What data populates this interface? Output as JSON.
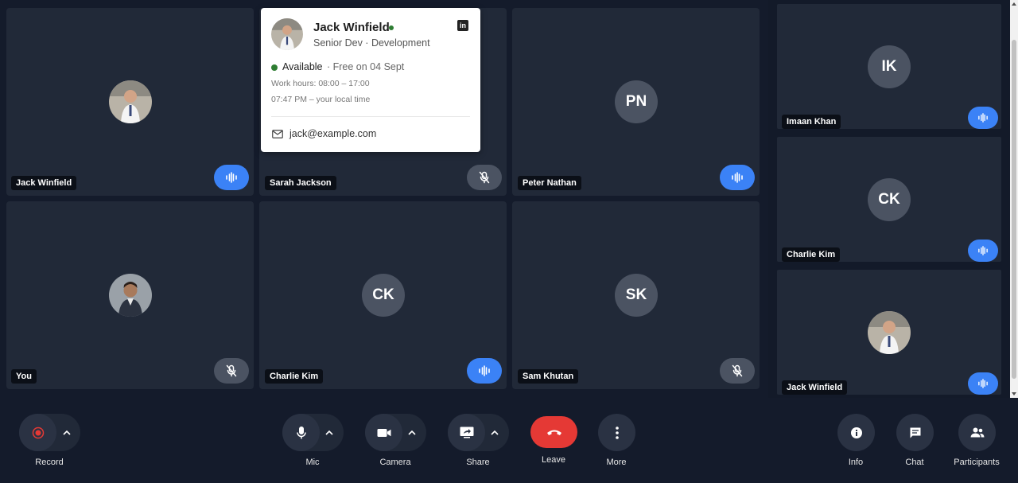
{
  "tiles": [
    {
      "name": "Jack Winfield",
      "avatar_type": "photo",
      "mic": "active"
    },
    {
      "name": "Sarah Jackson",
      "avatar_type": "none",
      "mic": "muted"
    },
    {
      "name": "Peter Nathan",
      "initials": "PN",
      "mic": "active"
    },
    {
      "name": "You",
      "avatar_type": "photo",
      "mic": "muted"
    },
    {
      "name": "Charlie Kim",
      "initials": "CK",
      "mic": "active"
    },
    {
      "name": "Sam Khutan",
      "initials": "SK",
      "mic": "muted"
    }
  ],
  "sidebar": [
    {
      "name": "Imaan Khan",
      "initials": "IK",
      "mic": "active"
    },
    {
      "name": "Charlie Kim",
      "initials": "CK",
      "mic": "active"
    },
    {
      "name": "Jack Winfield",
      "avatar_type": "photo",
      "mic": "active"
    }
  ],
  "popover": {
    "name": "Jack Winfield",
    "role": "Senior Dev · Development",
    "status": "Available",
    "free": "· Free on 04 Sept",
    "work_hours": "Work hours: 08:00 – 17:00",
    "local_time": "07:47 PM – your local time",
    "email": "jack@example.com",
    "linkedin_icon": "linkedin-icon",
    "status_color": "#2e7d32"
  },
  "toolbar": {
    "record": "Record",
    "mic": "Mic",
    "camera": "Camera",
    "share": "Share",
    "leave": "Leave",
    "more": "More",
    "info": "Info",
    "chat": "Chat",
    "participants": "Participants"
  },
  "colors": {
    "background": "#141b2b",
    "tile": "#212938",
    "mic_active": "#3b82f6",
    "mic_muted": "#4b5362",
    "leave": "#e53935"
  }
}
